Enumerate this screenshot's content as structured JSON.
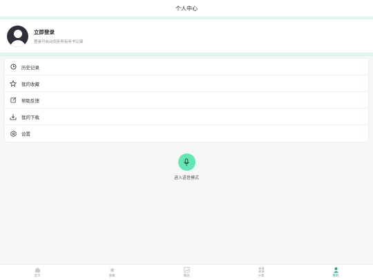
{
  "header": {
    "title": "个人中心"
  },
  "profile": {
    "login_title": "立即登录",
    "login_subtitle": "登录可自动同步所有听书记录"
  },
  "menu": {
    "items": [
      {
        "label": "历史记录",
        "icon": "clock-icon"
      },
      {
        "label": "我的收藏",
        "icon": "star-icon"
      },
      {
        "label": "帮助反馈",
        "icon": "edit-icon"
      },
      {
        "label": "我的下载",
        "icon": "download-icon"
      },
      {
        "label": "设置",
        "icon": "gear-icon"
      }
    ],
    "chevron": "›"
  },
  "voice": {
    "label": "进入语音模式",
    "accent": "#63e6b4"
  },
  "tabbar": {
    "items": [
      {
        "label": "首页",
        "icon": "home-icon"
      },
      {
        "label": "收藏",
        "icon": "star-icon"
      },
      {
        "label": "播放",
        "icon": "play-icon"
      },
      {
        "label": "分类",
        "icon": "grid-icon"
      },
      {
        "label": "我的",
        "icon": "user-icon"
      }
    ],
    "active_color": "#2a9d8f"
  }
}
